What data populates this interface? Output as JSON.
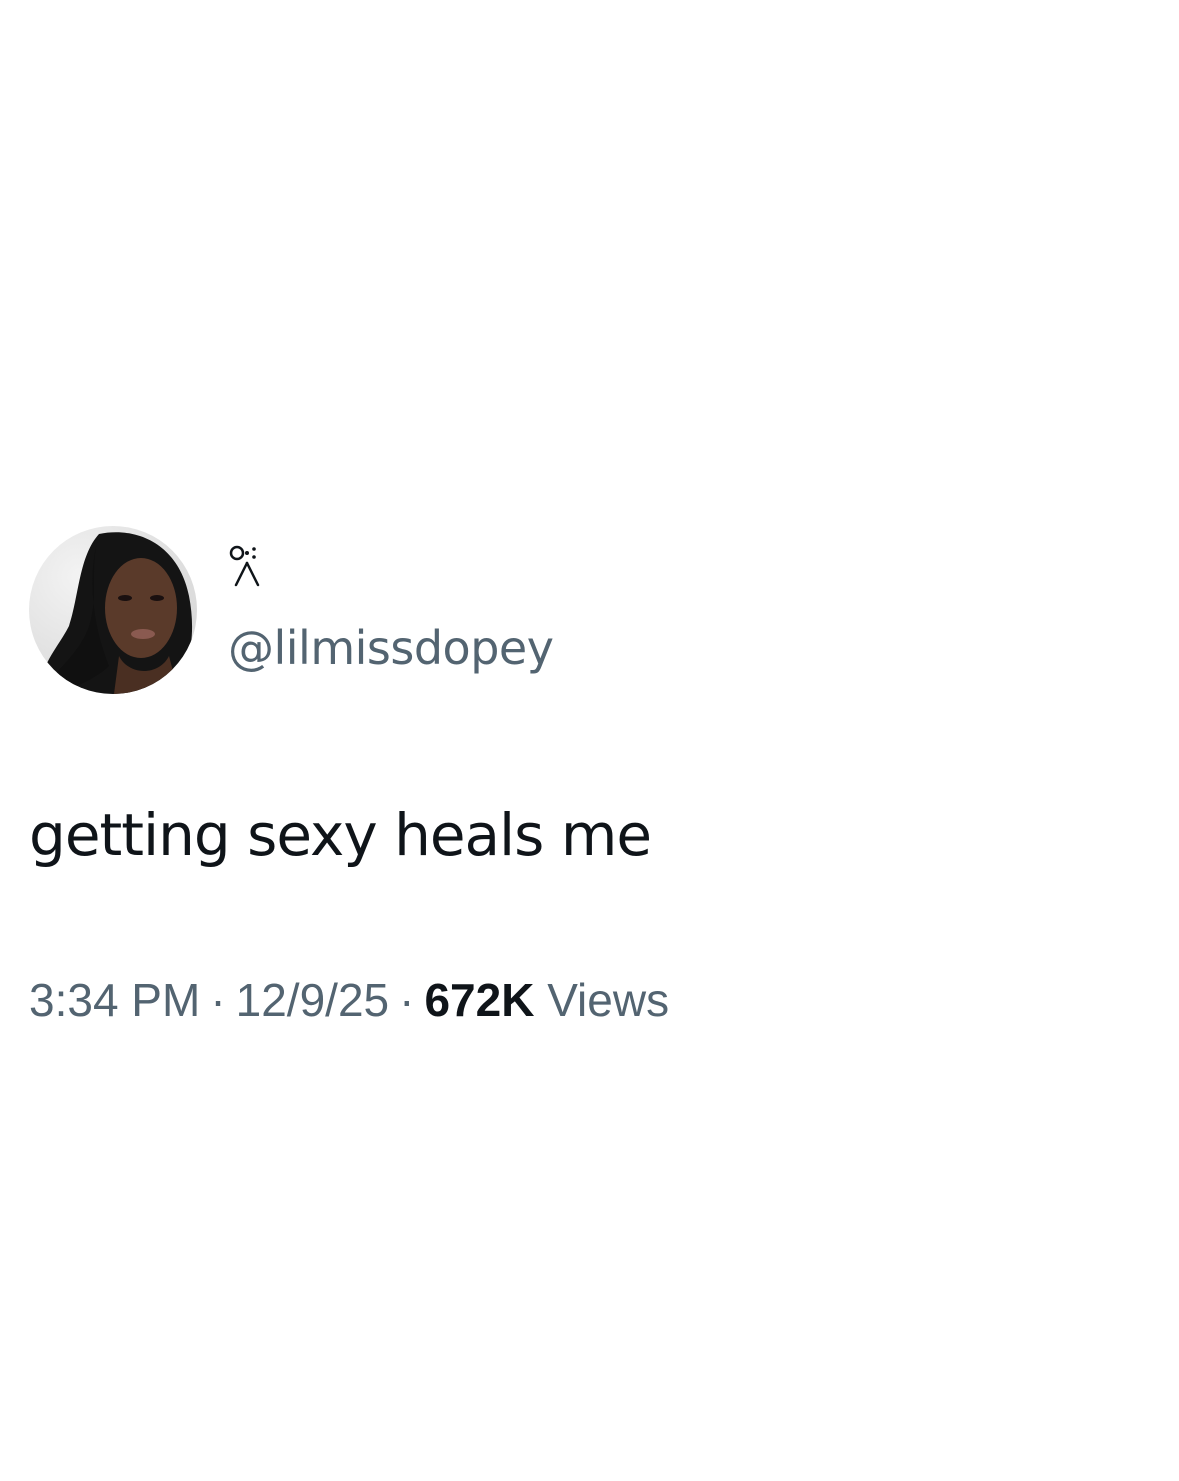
{
  "author": {
    "display_name_icon": "bow-emoji-icon",
    "handle": "@lilmissdopey",
    "avatar": "profile-photo"
  },
  "tweet": {
    "text": "getting sexy heals me"
  },
  "meta": {
    "time": "3:34 PM",
    "separator": "·",
    "date": "12/9/25",
    "views_count": "672K",
    "views_label": "Views"
  },
  "colors": {
    "text_primary": "#0f1419",
    "text_secondary": "#536471",
    "background": "#ffffff"
  }
}
